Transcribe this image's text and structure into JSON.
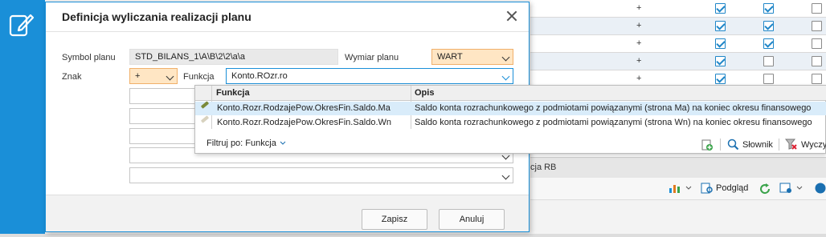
{
  "background": {
    "rows": [
      {
        "plus": "+",
        "c1": true,
        "c2": true,
        "c3": false
      },
      {
        "plus": "+",
        "c1": true,
        "c2": true,
        "c3": false
      },
      {
        "plus": "+",
        "c1": true,
        "c2": true,
        "c3": false
      },
      {
        "plus": "+",
        "c1": true,
        "c2": false,
        "c3": false
      },
      {
        "plus": "+",
        "c1": true,
        "c2": false,
        "c3": false
      }
    ],
    "tab_fragment": "cja RB",
    "toolbar": {
      "preview_label": "Podgląd"
    }
  },
  "dialog": {
    "title": "Definicja wyliczania realizacji planu",
    "symbol_label": "Symbol planu",
    "symbol_value": "STD_BILANS_1\\A\\B\\2\\2\\a\\a",
    "dimension_label": "Wymiar planu",
    "dimension_value": "WART",
    "sign_label": "Znak",
    "sign_value": "+",
    "function_label": "Funkcja",
    "function_value": "Konto.ROzr.ro",
    "save_label": "Zapisz",
    "cancel_label": "Anuluj"
  },
  "popup": {
    "col_function": "Funkcja",
    "col_description": "Opis",
    "rows": [
      {
        "function": "Konto.Rozr.RodzajePow.OkresFin.Saldo.Ma",
        "description": "Saldo konta rozrachunkowego z podmiotami powiązanymi  (strona Ma) na koniec okresu finansowego"
      },
      {
        "function": "Konto.Rozr.RodzajePow.OkresFin.Saldo.Wn",
        "description": "Saldo konta rozrachunkowego z podmiotami powiązanymi  (strona Wn) na koniec okresu finansowego"
      }
    ],
    "filter_label": "Filtruj po: Funkcja",
    "dictionary_label": "Słownik",
    "clear_label": "Wyczyś"
  },
  "colors": {
    "accent": "#1a8fd8",
    "orange_field": "#ffe6c4",
    "selected_row": "#d9ecfa"
  }
}
